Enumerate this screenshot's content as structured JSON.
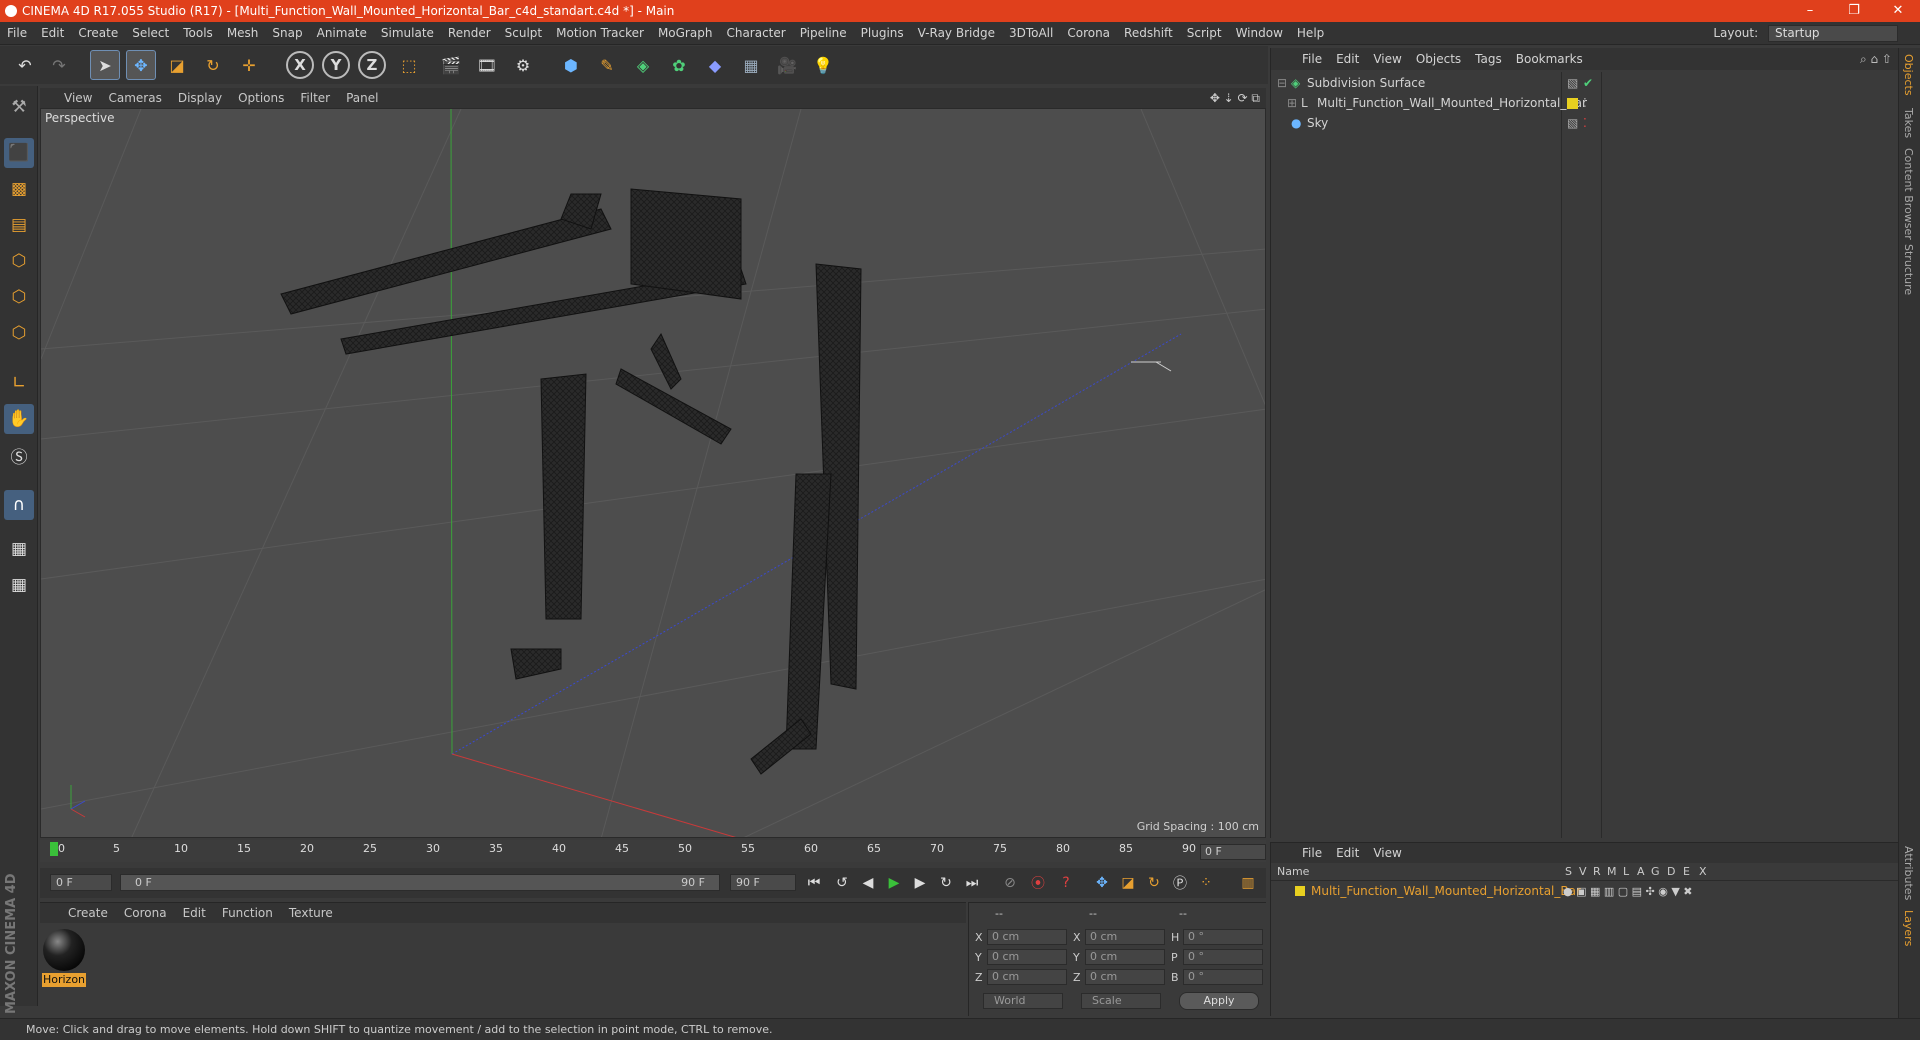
{
  "titlebar": {
    "title": "CINEMA 4D R17.055 Studio (R17) - [Multi_Function_Wall_Mounted_Horizontal_Bar_c4d_standart.c4d *] - Main",
    "minimize": "–",
    "maximize": "❐",
    "close": "✕"
  },
  "menubar": {
    "items": [
      "File",
      "Edit",
      "Create",
      "Select",
      "Tools",
      "Mesh",
      "Snap",
      "Animate",
      "Simulate",
      "Render",
      "Sculpt",
      "Motion Tracker",
      "MoGraph",
      "Character",
      "Pipeline",
      "Plugins",
      "V-Ray Bridge",
      "3DToAll",
      "Corona",
      "Redshift",
      "Script",
      "Window",
      "Help"
    ],
    "layout_label": "Layout:",
    "layout_value": "Startup"
  },
  "toolbar": {
    "x_label": "X",
    "y_label": "Y",
    "z_label": "Z"
  },
  "viewport": {
    "menu": [
      "View",
      "Cameras",
      "Display",
      "Options",
      "Filter",
      "Panel"
    ],
    "view_name": "Perspective",
    "grid_spacing": "Grid Spacing : 100 cm"
  },
  "timeline": {
    "ticks": [
      "0",
      "5",
      "10",
      "15",
      "20",
      "25",
      "30",
      "35",
      "40",
      "45",
      "50",
      "55",
      "60",
      "65",
      "70",
      "75",
      "80",
      "85",
      "90"
    ],
    "current_frame": "0 F"
  },
  "playbar": {
    "start": "0 F",
    "range_start": "0 F",
    "range_end": "90 F",
    "end": "90 F"
  },
  "material_manager": {
    "menu": [
      "Create",
      "Corona",
      "Edit",
      "Function",
      "Texture"
    ],
    "materials": [
      {
        "name": "Horizon"
      }
    ]
  },
  "coords": {
    "headers": [
      "--",
      "--",
      "--"
    ],
    "rows": [
      {
        "l1": "X",
        "v1": "0 cm",
        "l2": "X",
        "v2": "0 cm",
        "l3": "H",
        "v3": "0 °"
      },
      {
        "l1": "Y",
        "v1": "0 cm",
        "l2": "Y",
        "v2": "0 cm",
        "l3": "P",
        "v3": "0 °"
      },
      {
        "l1": "Z",
        "v1": "0 cm",
        "l2": "Z",
        "v2": "0 cm",
        "l3": "B",
        "v3": "0 °"
      }
    ],
    "space": "World",
    "mode": "Scale",
    "apply": "Apply"
  },
  "object_manager": {
    "menu": [
      "File",
      "Edit",
      "View",
      "Objects",
      "Tags",
      "Bookmarks"
    ],
    "objects": [
      {
        "name": "Subdivision Surface"
      },
      {
        "name": "Multi_Function_Wall_Mounted_Horizontal_Bar"
      },
      {
        "name": "Sky"
      }
    ]
  },
  "layer_manager": {
    "menu": [
      "File",
      "Edit",
      "View"
    ],
    "columns": [
      "Name",
      "S",
      "V",
      "R",
      "M",
      "L",
      "A",
      "G",
      "D",
      "E",
      "X"
    ],
    "layers": [
      {
        "name": "Multi_Function_Wall_Mounted_Horizontal_Bar"
      }
    ]
  },
  "right_tabs": [
    "Objects",
    "Takes",
    "Content Browser",
    "Structure",
    "Attributes",
    "Layers"
  ],
  "status": "Move: Click and drag to move elements. Hold down SHIFT to quantize movement / add to the selection in point mode, CTRL to remove.",
  "brand": "MAXON CINEMA 4D",
  "colors": {
    "accent": "#e0401c",
    "selection": "#e8a030",
    "layer": "#e8c020"
  }
}
